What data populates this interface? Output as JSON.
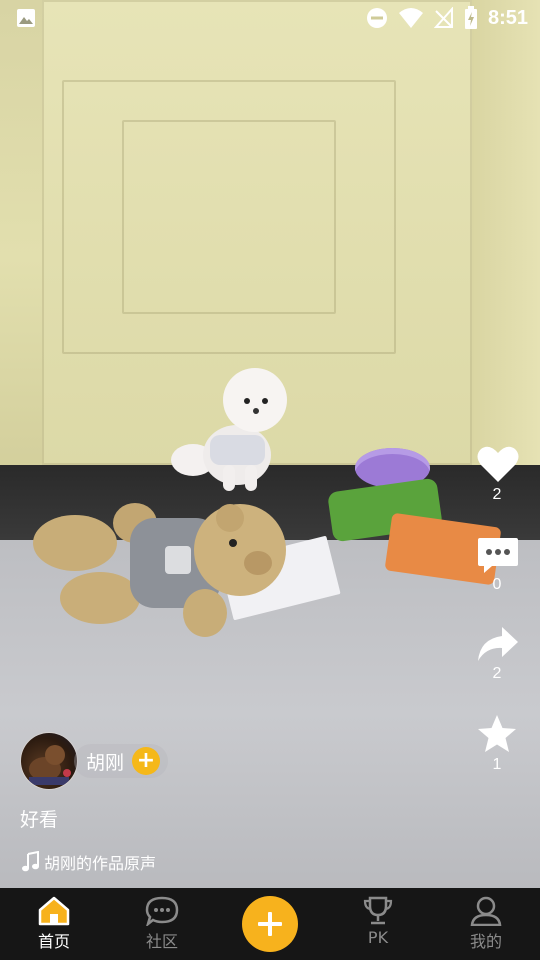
{
  "status_bar": {
    "time": "8:51"
  },
  "actions": {
    "like": {
      "count": "2"
    },
    "comment": {
      "count": "0"
    },
    "share": {
      "count": "2"
    },
    "favorite": {
      "count": "1"
    }
  },
  "author": {
    "name": "胡刚",
    "follow_label": "+"
  },
  "caption": "好看",
  "music": "胡刚的作品原声",
  "tabs": [
    {
      "label": "首页",
      "icon": "home-icon",
      "active": true
    },
    {
      "label": "社区",
      "icon": "chat-bubble-icon"
    },
    {
      "label": "",
      "icon": "plus-icon"
    },
    {
      "label": "PK",
      "icon": "trophy-icon"
    },
    {
      "label": "我的",
      "icon": "person-icon"
    }
  ],
  "colors": {
    "accent": "#f7b21d",
    "tabbar_bg": "#161616",
    "inactive": "#8b8b8b"
  }
}
